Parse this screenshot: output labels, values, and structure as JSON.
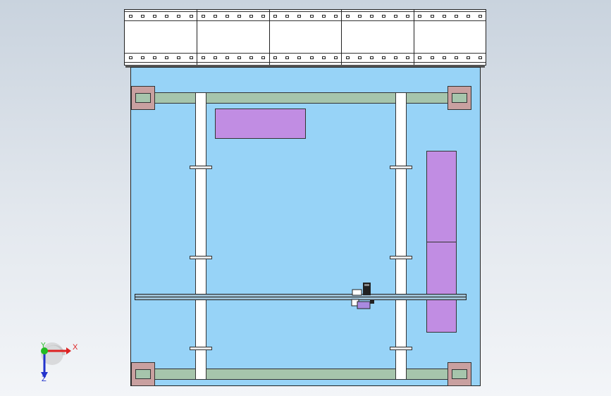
{
  "triad": {
    "x_label": "X",
    "y_label": "Y",
    "z_label": "Z",
    "x_color": "#dd2222",
    "y_color": "#22bb22",
    "z_color": "#2233cc"
  },
  "colors": {
    "background_top": "#c9d3de",
    "plate": "#97d3f7",
    "rail": "#a6c5ac",
    "pad": "#c9a0a0",
    "part": "#c18de3",
    "post": "#ffffff"
  }
}
